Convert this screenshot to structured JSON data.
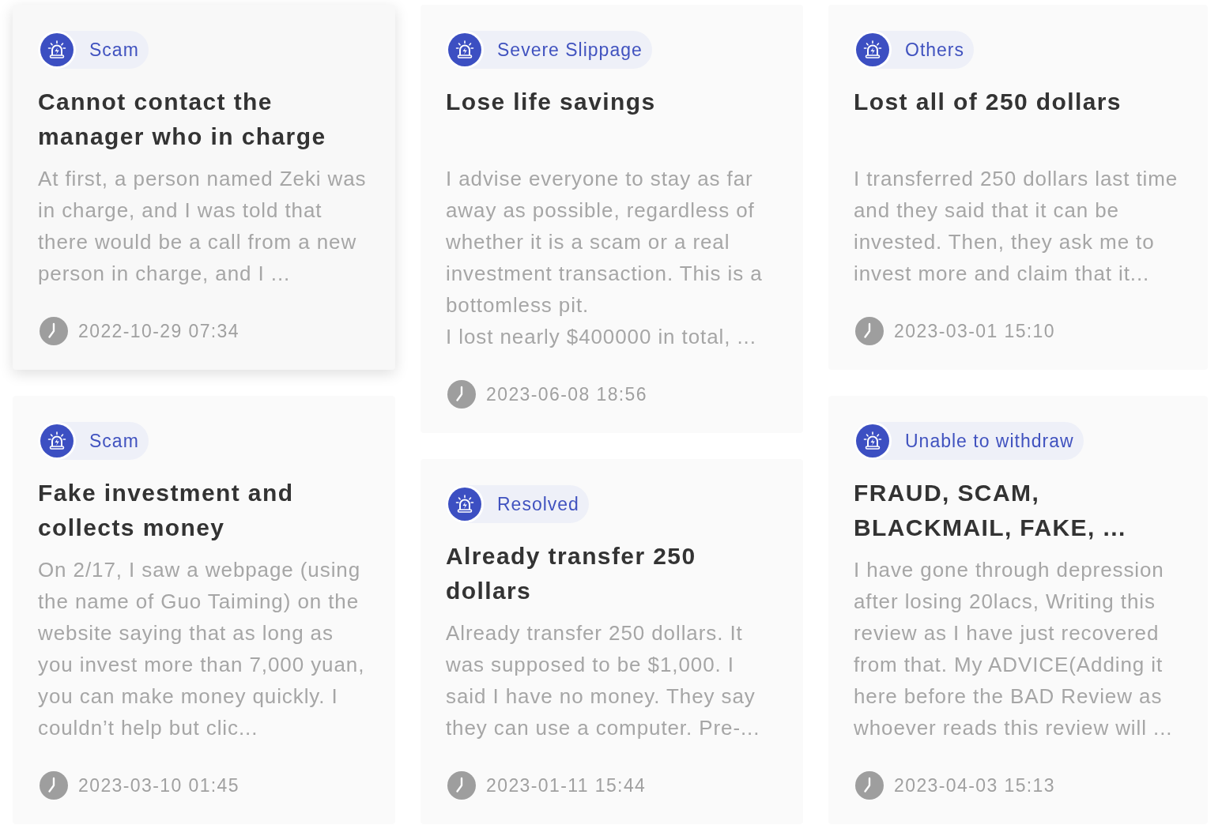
{
  "columns": [
    {
      "cards": [
        {
          "tag": "Scam",
          "title": "Cannot contact the manager who in charge",
          "body": "At first, a person named Zeki was in charge, and I was told that there would be a call from a new person in charge, and I ...",
          "date": "2022-10-29 07:34",
          "highlighted": true
        },
        {
          "tag": "Scam",
          "title": "Fake investment and collects money",
          "body": "On 2/17, I saw a webpage (using the name of Guo Taiming) on the website saying that as long as you invest more than 7,000 yuan, you can make money quickly. I couldn’t help but clic...",
          "date": "2023-03-10 01:45",
          "highlighted": false
        }
      ]
    },
    {
      "cards": [
        {
          "tag": "Severe Slippage",
          "title": "Lose life savings",
          "body": "I advise everyone to stay as far away as possible, regardless of whether it is a scam or a real investment transaction. This is a bottomless pit.\nI lost nearly $400000 in total, ...",
          "date": "2023-06-08 18:56",
          "highlighted": false
        },
        {
          "tag": "Resolved",
          "title": "Already transfer 250 dollars",
          "body": "Already transfer 250 dollars. It was supposed to be $1,000. I said I have no money. They say they can use a computer. Pre-...",
          "date": "2023-01-11 15:44",
          "highlighted": false
        }
      ]
    },
    {
      "cards": [
        {
          "tag": "Others",
          "title": "Lost all of 250 dollars",
          "body": "I transferred 250 dollars last time and they said that it can be invested. Then, they ask me to invest more and claim that it...",
          "date": "2023-03-01 15:10",
          "highlighted": false
        },
        {
          "tag": "Unable to withdraw",
          "title": "FRAUD, SCAM, BLACKMAIL, FAKE, ...",
          "body": "I have gone through depression after losing 20lacs, Writing this review as I have just recovered from that. My ADVICE(Adding it here before the BAD Review as whoever reads this review will ...",
          "date": "2023-04-03 15:13",
          "highlighted": false
        }
      ]
    }
  ]
}
